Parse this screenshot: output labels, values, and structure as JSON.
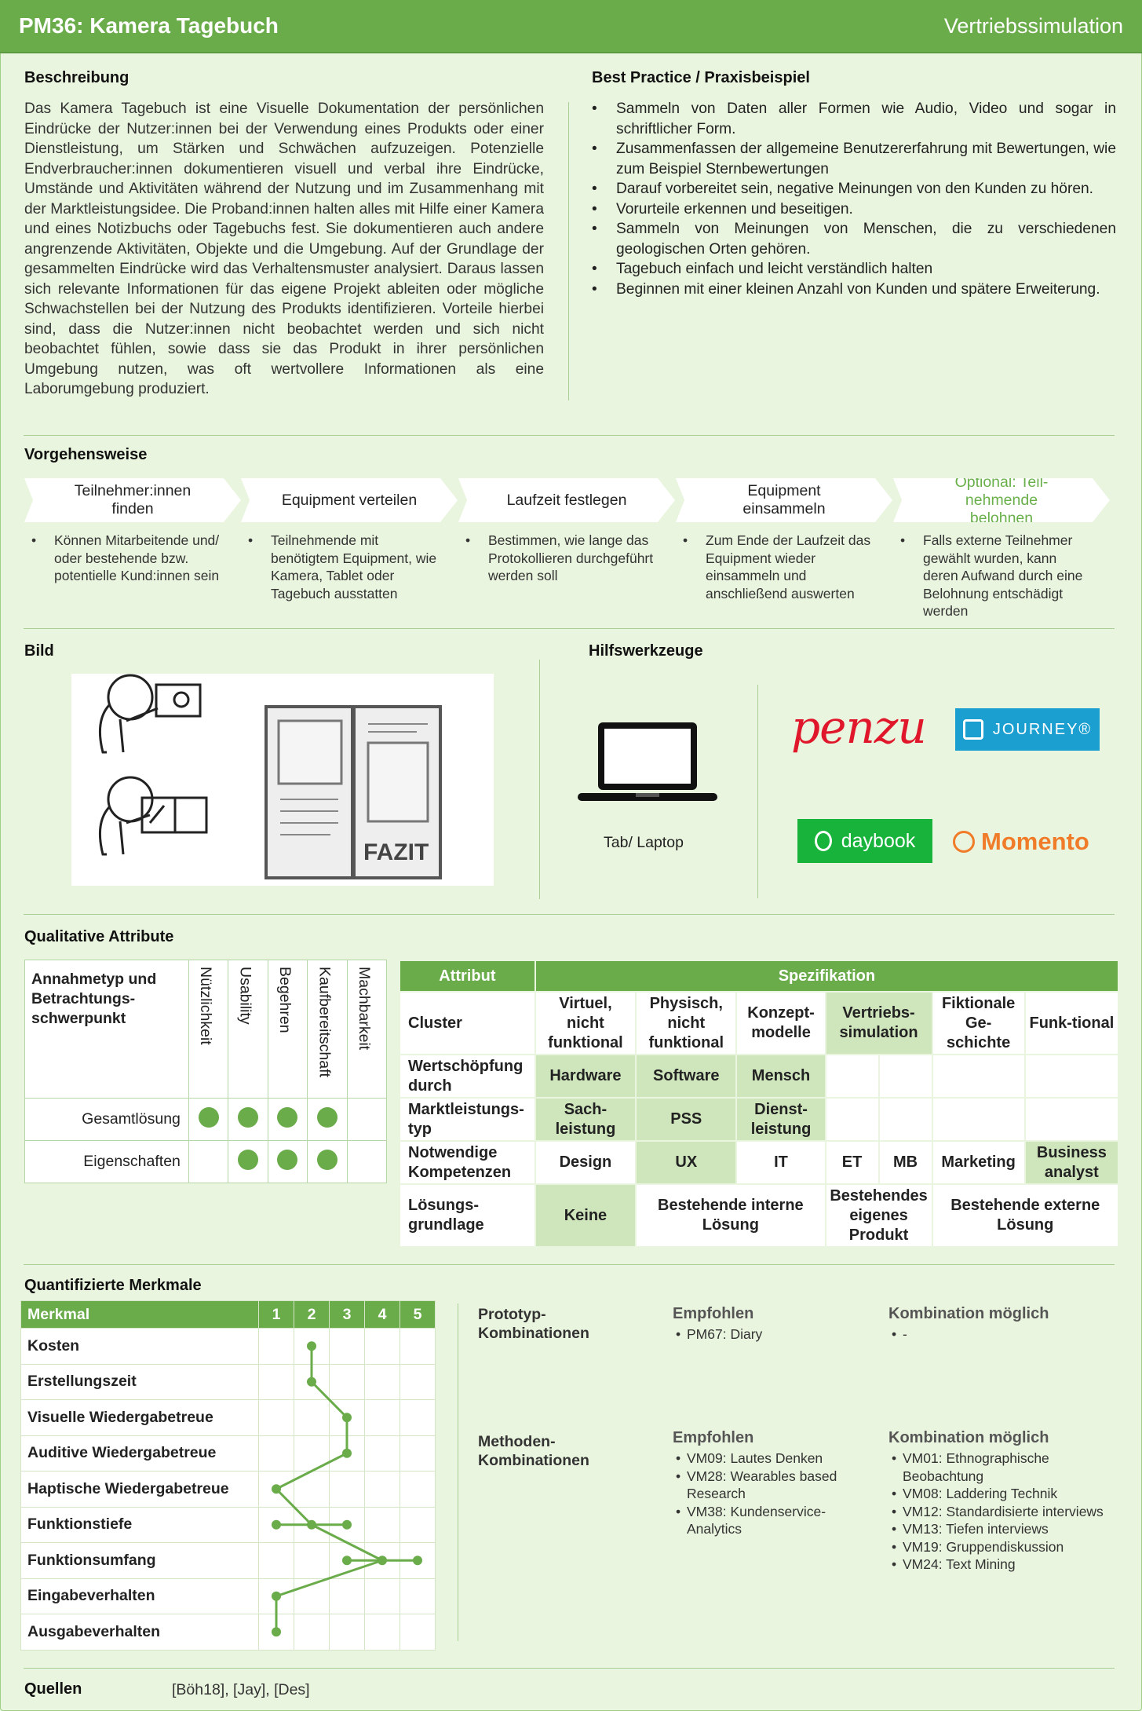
{
  "header": {
    "title": "PM36: Kamera Tagebuch",
    "category": "Vertriebssimulation"
  },
  "beschreibung": {
    "heading": "Beschreibung",
    "text": "Das Kamera Tagebuch ist eine Visuelle Dokumentation der persönlichen Eindrücke der Nutzer:innen bei der Verwendung eines Produkts oder einer Dienstleistung, um Stärken und Schwächen aufzuzeigen. Potenzielle Endverbraucher:innen dokumentieren visuell und verbal ihre Eindrücke, Umstände und Aktivitäten während der Nutzung und im Zusammenhang mit der Marktleistungsidee. Die Proband:innen halten alles mit Hilfe einer Kamera und eines Notizbuchs oder Tagebuchs fest. Sie dokumentieren auch andere angrenzende Aktivitäten, Objekte und die Umgebung. Auf der Grundlage der gesammelten Eindrücke wird das Verhaltensmuster analysiert. Daraus lassen sich relevante Informationen für das eigene Projekt ableiten oder mögliche Schwachstellen bei der Nutzung des Produkts identifizieren. Vorteile hierbei sind, dass die Nutzer:innen nicht beobachtet werden und sich nicht beobachtet fühlen, sowie dass sie das Produkt in ihrer persönlichen Umgebung nutzen, was oft wertvollere Informationen als eine Laborumgebung produziert."
  },
  "best_practice": {
    "heading": "Best Practice / Praxisbeispiel",
    "items": [
      "Sammeln von Daten aller Formen wie Audio, Video und sogar in schriftlicher Form.",
      "Zusammenfassen der allgemeine Benutzererfahrung mit Bewertungen, wie zum Beispiel Sternbewertungen",
      "Darauf vorbereitet sein, negative Meinungen von den Kunden zu hören.",
      "Vorurteile erkennen und beseitigen.",
      "Sammeln von Meinungen von Menschen, die zu verschiedenen geologischen Orten gehören.",
      "Tagebuch einfach und leicht verständlich halten",
      "Beginnen mit einer kleinen Anzahl von Kunden und spätere Erweiterung."
    ]
  },
  "vorgehen": {
    "heading": "Vorgehensweise",
    "steps": [
      {
        "title": "Teilnehmer:innen finden",
        "desc": "Können Mitarbeitende und/ oder bestehende bzw. potentielle Kund:innen sein"
      },
      {
        "title": "Equipment verteilen",
        "desc": "Teilnehmende mit benötigtem Equipment, wie Kamera, Tablet oder Tagebuch ausstatten"
      },
      {
        "title": "Laufzeit festlegen",
        "desc": "Bestimmen, wie lange das Protokollieren durchgeführt werden soll"
      },
      {
        "title": "Equipment einsammeln",
        "desc": "Zum Ende der Laufzeit das Equipment wieder einsammeln und anschließend auswerten"
      },
      {
        "title": "Optional: Teil-nehmende belohnen",
        "desc": "Falls externe Teilnehmer gewählt wurden, kann deren Aufwand durch eine Belohnung entschädigt werden"
      }
    ]
  },
  "bild": {
    "heading": "Bild",
    "fazit": "FAZIT"
  },
  "hilfswerkzeuge": {
    "heading": "Hilfswerkzeuge",
    "device_label": "Tab/ Laptop",
    "logos": {
      "penzu": "penzu",
      "journey": "JOURNEY®",
      "daybook": "daybook",
      "momento": "Momento"
    }
  },
  "qualitative": {
    "heading": "Qualitative Attribute",
    "left": {
      "corner": "Annahmetyp und Betrachtungs-schwerpunkt",
      "columns": [
        "Nützlichkeit",
        "Usability",
        "Begehren",
        "Kaufbereitschaft",
        "Machbarkeit"
      ],
      "rows": [
        {
          "label": "Gesamtlösung",
          "dots": [
            true,
            true,
            true,
            true,
            false
          ]
        },
        {
          "label": "Eigenschaften",
          "dots": [
            false,
            true,
            true,
            true,
            false
          ]
        }
      ]
    },
    "right": {
      "col_attr": "Attribut",
      "col_spec": "Spezifikation",
      "rows": [
        {
          "label": "Cluster",
          "cells": [
            "Virtuel, nicht funktional",
            "Physisch, nicht funktional",
            "Konzept-modelle",
            "Vertriebs-simulation",
            "Fiktionale Ge-schichte",
            "Funk-tional"
          ]
        },
        {
          "label": "Wertschöpfung durch",
          "cells": [
            "Hardware",
            "Software",
            "Mensch"
          ]
        },
        {
          "label": "Marktleistungs-typ",
          "cells": [
            "Sach-leistung",
            "PSS",
            "Dienst-leistung"
          ]
        },
        {
          "label": "Notwendige Kompetenzen",
          "cells": [
            "Design",
            "UX",
            "IT",
            "ET",
            "MB",
            "Marketing",
            "Business analyst"
          ]
        },
        {
          "label": "Lösungs-grundlage",
          "cells": [
            "Keine",
            "Bestehende interne Lösung",
            "Bestehendes eigenes Produkt",
            "Bestehende externe Lösung"
          ]
        }
      ]
    }
  },
  "quantifiziert": {
    "heading": "Quantifizierte Merkmale",
    "col_label": "Merkmal",
    "scale": [
      "1",
      "2",
      "3",
      "4",
      "5"
    ],
    "rows": [
      {
        "label": "Kosten",
        "values": [
          2
        ]
      },
      {
        "label": "Erstellungszeit",
        "values": [
          2
        ]
      },
      {
        "label": "Visuelle Wiedergabetreue",
        "values": [
          3
        ]
      },
      {
        "label": "Auditive Wiedergabetreue",
        "values": [
          3
        ]
      },
      {
        "label": "Haptische Wiedergabetreue",
        "values": [
          1
        ]
      },
      {
        "label": "Funktionstiefe",
        "values": [
          1,
          2,
          3
        ]
      },
      {
        "label": "Funktionsumfang",
        "values": [
          3,
          4,
          5
        ]
      },
      {
        "label": "Eingabeverhalten",
        "values": [
          1
        ]
      },
      {
        "label": "Ausgabeverhalten",
        "values": [
          1
        ]
      }
    ]
  },
  "kombinationen": {
    "prototyp": {
      "label": "Prototyp-Kombinationen",
      "empf_head": "Empfohlen",
      "empf": [
        "PM67: Diary"
      ],
      "komb_head": "Kombination möglich",
      "komb": [
        "-"
      ]
    },
    "methoden": {
      "label": "Methoden-Kombinationen",
      "empf_head": "Empfohlen",
      "empf": [
        "VM09: Lautes Denken",
        "VM28: Wearables based Research",
        "VM38: Kundenservice-Analytics"
      ],
      "komb_head": "Kombination möglich",
      "komb": [
        "VM01: Ethnographische Beobachtung",
        "VM08: Laddering Technik",
        "VM12: Standardisierte interviews",
        "VM13: Tiefen interviews",
        "VM19: Gruppendiskussion",
        "VM24: Text Mining"
      ]
    }
  },
  "quellen": {
    "label": "Quellen",
    "text": "[Böh18], [Jay], [Des]"
  },
  "colors": {
    "accent": "#6aab4a",
    "background": "#e9f5de",
    "highlight": "#cfe6bd"
  }
}
